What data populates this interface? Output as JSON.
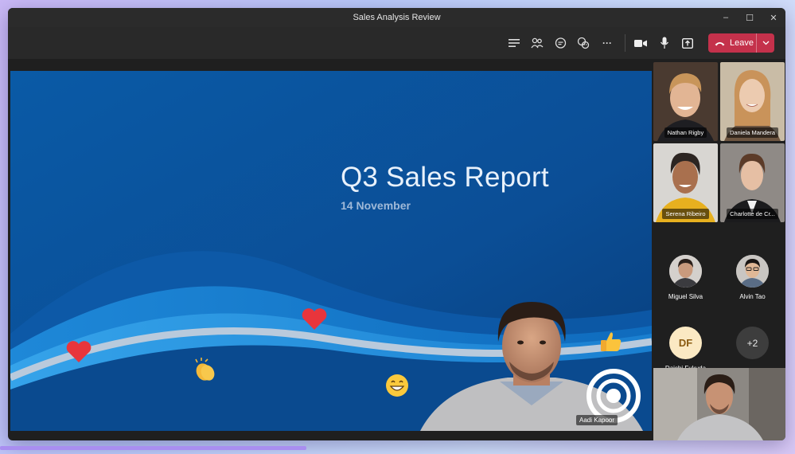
{
  "window": {
    "title": "Sales Analysis Review",
    "controls": {
      "minimize": "–",
      "maximize": "☐",
      "close": "✕"
    }
  },
  "toolbar": {
    "icons": [
      "chat-list-icon",
      "people-icon",
      "chat-icon",
      "reactions-icon",
      "more-icon",
      "camera-icon",
      "mic-icon",
      "share-icon"
    ],
    "more_label": "···",
    "leave_label": "Leave",
    "leave_color": "#c4314b"
  },
  "slide": {
    "title": "Q3 Sales Report",
    "date": "14 November",
    "background": "#0b4e96"
  },
  "reactions": [
    "heart",
    "heart",
    "clap",
    "laugh",
    "thumbs-up"
  ],
  "presenter": {
    "name": "Aadi Kapoor"
  },
  "gallery": {
    "video_tiles": [
      {
        "name": "Nathan Rigby"
      },
      {
        "name": "Daniela Mandera"
      },
      {
        "name": "Serena Ribeiro"
      },
      {
        "name": "Charlotte de Cr..."
      }
    ],
    "audience": [
      {
        "name": "Miguel Silva"
      },
      {
        "name": "Alvin Tao"
      },
      {
        "name": "Daichi Fukuda",
        "initials": "DF"
      },
      {
        "name": "",
        "overflow": "+2"
      }
    ]
  }
}
